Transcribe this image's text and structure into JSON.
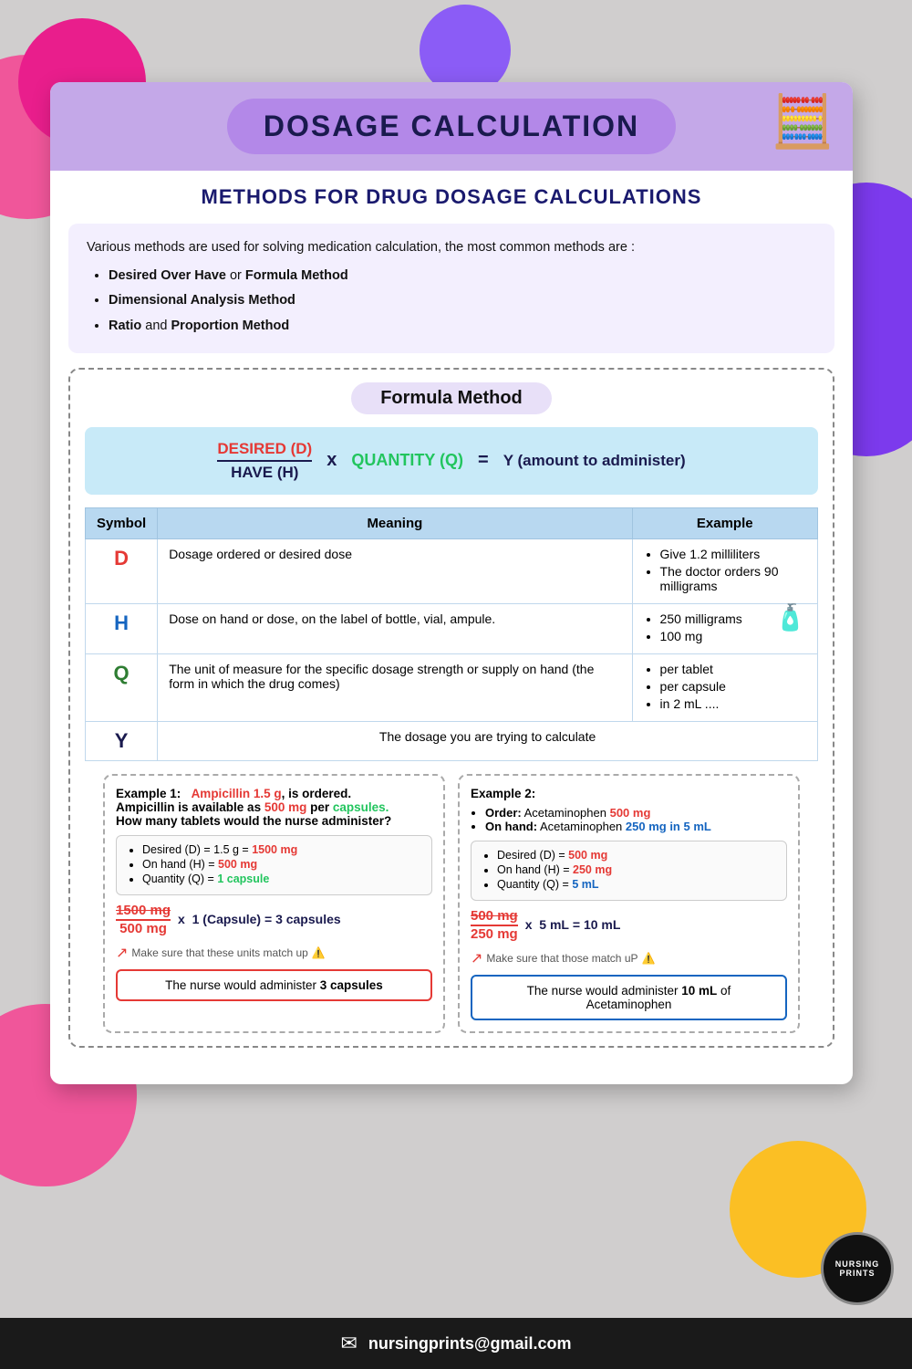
{
  "background": {
    "color": "#d0cece"
  },
  "card": {
    "title": "DOSAGE CALCULATION",
    "methods_title": "METHODS FOR DRUG DOSAGE CALCULATIONS",
    "intro_text": "Various methods are used for solving medication calculation,  the most common methods are :",
    "bullet_methods": [
      "Desired Over Have or Formula Method",
      "Dimensional Analysis Method",
      "Ratio and Proportion Method"
    ],
    "formula_section": {
      "label": "Formula Method",
      "desired_label": "DESIRED (D)",
      "have_label": "HAVE (H)",
      "times": "x",
      "quantity_label": "QUANTITY (Q)",
      "equals": "=",
      "y_label": "Y (amount to administer)"
    },
    "table": {
      "headers": [
        "Symbol",
        "Meaning",
        "Example"
      ],
      "rows": [
        {
          "symbol": "D",
          "meaning": "Dosage ordered or desired dose",
          "examples": [
            "Give 1.2 milliliters",
            "The doctor orders 90 milligrams"
          ]
        },
        {
          "symbol": "H",
          "meaning": "Dose on hand or dose, on the label of bottle, vial, ampule.",
          "examples": [
            "250 milligrams",
            "100 mg"
          ],
          "has_bottle": true
        },
        {
          "symbol": "Q",
          "meaning": "The unit of measure for the specific dosage strength or supply on hand (the form in which the drug comes)",
          "examples": [
            "per tablet",
            "per capsule",
            "in 2 mL ...."
          ]
        },
        {
          "symbol": "Y",
          "meaning": "The dosage you are trying to calculate",
          "full_row": true
        }
      ]
    },
    "example1": {
      "title": "Example 1:",
      "drug": "Ampicillin",
      "order_detail": "1.5 g, is ordered.",
      "note": "Ampicillin is available as",
      "avail": "500 mg per",
      "avail_unit": "capsules.",
      "question": "How many tablets would the nurse administer?",
      "bullets": [
        "Desired (D) = 1.5 g = 1500 mg",
        "On hand (H) = 500 mg",
        "Quantity (Q) = 1 capsule"
      ],
      "numerator": "1500 mg",
      "denominator": "500 mg",
      "calc_middle": "x  1 (Capsule)  =  3 capsules",
      "match_note": "Make sure that these units match up",
      "answer": "The nurse would administer 3 capsules"
    },
    "example2": {
      "title": "Example 2:",
      "bullet1_label": "Order:",
      "bullet1": "Acetaminophen",
      "bullet1_dose": "500 mg",
      "bullet2_label": "On hand:",
      "bullet2": "Acetaminophen",
      "bullet2_detail": "250 mg in 5 mL",
      "bullets": [
        "Desired (D) = 500 mg",
        "On hand (H) = 250 mg",
        "Quantity (Q) = 5 mL"
      ],
      "numerator": "500 mg",
      "denominator": "250 mg",
      "calc_middle": "x  5 mL  =  10 mL",
      "match_note": "Make sure that those match uP",
      "answer": "The nurse would administer 10 mL of Acetaminophen"
    }
  },
  "footer": {
    "email": "nursingprints@gmail.com"
  },
  "badge": {
    "line1": "NURSING",
    "line2": "PRINTS"
  }
}
